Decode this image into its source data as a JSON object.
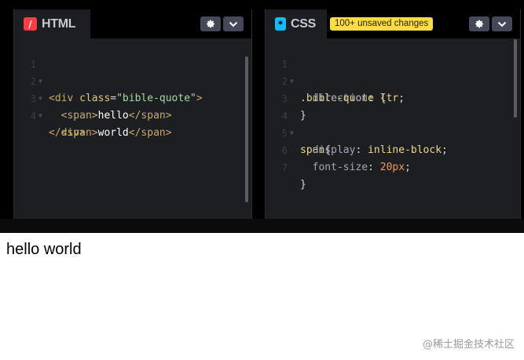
{
  "html_panel": {
    "title": "HTML",
    "icon": "/",
    "icon_color": "#ff3c41",
    "lines": [
      "1",
      "2",
      "3",
      "4"
    ],
    "code": {
      "l1_open": "<div ",
      "l1_attr": "class",
      "l1_eq": "=",
      "l1_str": "\"bible-quote\"",
      "l1_close": ">",
      "l2_open": "<span>",
      "l2_text": "hello",
      "l2_close": "</span>",
      "l3_open": "<span>",
      "l3_text": "world",
      "l3_close": "</span>",
      "l4": "</div>"
    }
  },
  "css_panel": {
    "title": "CSS",
    "icon": "*",
    "icon_color": "#0ebeff",
    "badge": "100+ unsaved changes",
    "lines": [
      "1",
      "2",
      "3",
      "4",
      "5",
      "6",
      "7"
    ],
    "code": {
      "l1_sel": ".bible-quote",
      "l1_brace": " {",
      "l2_prop": "direction",
      "l2_colon": ": ",
      "l2_val": "ltr",
      "l2_semi": ";",
      "l3": "}",
      "l4_sel": "span",
      "l4_brace": "{",
      "l5_prop": "display",
      "l5_colon": ": ",
      "l5_val": "inline-block",
      "l5_semi": ";",
      "l6_prop": "font-size",
      "l6_colon": ": ",
      "l6_val": "20px",
      "l6_semi": ";",
      "l7": "}"
    }
  },
  "output": {
    "word1": "hello",
    "word2": "world"
  },
  "watermark": "@稀土掘金技术社区",
  "icons": {
    "settings": "gear-icon",
    "collapse": "chevron-down-icon"
  }
}
